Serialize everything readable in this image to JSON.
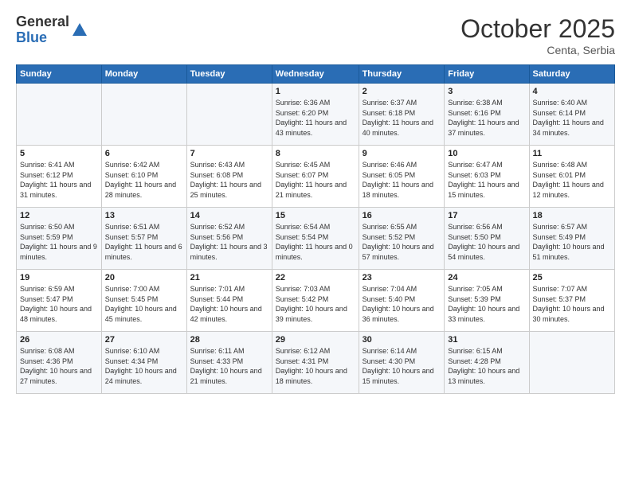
{
  "header": {
    "logo_general": "General",
    "logo_blue": "Blue",
    "month": "October 2025",
    "location": "Centa, Serbia"
  },
  "days_of_week": [
    "Sunday",
    "Monday",
    "Tuesday",
    "Wednesday",
    "Thursday",
    "Friday",
    "Saturday"
  ],
  "weeks": [
    [
      {
        "day": "",
        "info": ""
      },
      {
        "day": "",
        "info": ""
      },
      {
        "day": "",
        "info": ""
      },
      {
        "day": "1",
        "info": "Sunrise: 6:36 AM\nSunset: 6:20 PM\nDaylight: 11 hours and 43 minutes."
      },
      {
        "day": "2",
        "info": "Sunrise: 6:37 AM\nSunset: 6:18 PM\nDaylight: 11 hours and 40 minutes."
      },
      {
        "day": "3",
        "info": "Sunrise: 6:38 AM\nSunset: 6:16 PM\nDaylight: 11 hours and 37 minutes."
      },
      {
        "day": "4",
        "info": "Sunrise: 6:40 AM\nSunset: 6:14 PM\nDaylight: 11 hours and 34 minutes."
      }
    ],
    [
      {
        "day": "5",
        "info": "Sunrise: 6:41 AM\nSunset: 6:12 PM\nDaylight: 11 hours and 31 minutes."
      },
      {
        "day": "6",
        "info": "Sunrise: 6:42 AM\nSunset: 6:10 PM\nDaylight: 11 hours and 28 minutes."
      },
      {
        "day": "7",
        "info": "Sunrise: 6:43 AM\nSunset: 6:08 PM\nDaylight: 11 hours and 25 minutes."
      },
      {
        "day": "8",
        "info": "Sunrise: 6:45 AM\nSunset: 6:07 PM\nDaylight: 11 hours and 21 minutes."
      },
      {
        "day": "9",
        "info": "Sunrise: 6:46 AM\nSunset: 6:05 PM\nDaylight: 11 hours and 18 minutes."
      },
      {
        "day": "10",
        "info": "Sunrise: 6:47 AM\nSunset: 6:03 PM\nDaylight: 11 hours and 15 minutes."
      },
      {
        "day": "11",
        "info": "Sunrise: 6:48 AM\nSunset: 6:01 PM\nDaylight: 11 hours and 12 minutes."
      }
    ],
    [
      {
        "day": "12",
        "info": "Sunrise: 6:50 AM\nSunset: 5:59 PM\nDaylight: 11 hours and 9 minutes."
      },
      {
        "day": "13",
        "info": "Sunrise: 6:51 AM\nSunset: 5:57 PM\nDaylight: 11 hours and 6 minutes."
      },
      {
        "day": "14",
        "info": "Sunrise: 6:52 AM\nSunset: 5:56 PM\nDaylight: 11 hours and 3 minutes."
      },
      {
        "day": "15",
        "info": "Sunrise: 6:54 AM\nSunset: 5:54 PM\nDaylight: 11 hours and 0 minutes."
      },
      {
        "day": "16",
        "info": "Sunrise: 6:55 AM\nSunset: 5:52 PM\nDaylight: 10 hours and 57 minutes."
      },
      {
        "day": "17",
        "info": "Sunrise: 6:56 AM\nSunset: 5:50 PM\nDaylight: 10 hours and 54 minutes."
      },
      {
        "day": "18",
        "info": "Sunrise: 6:57 AM\nSunset: 5:49 PM\nDaylight: 10 hours and 51 minutes."
      }
    ],
    [
      {
        "day": "19",
        "info": "Sunrise: 6:59 AM\nSunset: 5:47 PM\nDaylight: 10 hours and 48 minutes."
      },
      {
        "day": "20",
        "info": "Sunrise: 7:00 AM\nSunset: 5:45 PM\nDaylight: 10 hours and 45 minutes."
      },
      {
        "day": "21",
        "info": "Sunrise: 7:01 AM\nSunset: 5:44 PM\nDaylight: 10 hours and 42 minutes."
      },
      {
        "day": "22",
        "info": "Sunrise: 7:03 AM\nSunset: 5:42 PM\nDaylight: 10 hours and 39 minutes."
      },
      {
        "day": "23",
        "info": "Sunrise: 7:04 AM\nSunset: 5:40 PM\nDaylight: 10 hours and 36 minutes."
      },
      {
        "day": "24",
        "info": "Sunrise: 7:05 AM\nSunset: 5:39 PM\nDaylight: 10 hours and 33 minutes."
      },
      {
        "day": "25",
        "info": "Sunrise: 7:07 AM\nSunset: 5:37 PM\nDaylight: 10 hours and 30 minutes."
      }
    ],
    [
      {
        "day": "26",
        "info": "Sunrise: 6:08 AM\nSunset: 4:36 PM\nDaylight: 10 hours and 27 minutes."
      },
      {
        "day": "27",
        "info": "Sunrise: 6:10 AM\nSunset: 4:34 PM\nDaylight: 10 hours and 24 minutes."
      },
      {
        "day": "28",
        "info": "Sunrise: 6:11 AM\nSunset: 4:33 PM\nDaylight: 10 hours and 21 minutes."
      },
      {
        "day": "29",
        "info": "Sunrise: 6:12 AM\nSunset: 4:31 PM\nDaylight: 10 hours and 18 minutes."
      },
      {
        "day": "30",
        "info": "Sunrise: 6:14 AM\nSunset: 4:30 PM\nDaylight: 10 hours and 15 minutes."
      },
      {
        "day": "31",
        "info": "Sunrise: 6:15 AM\nSunset: 4:28 PM\nDaylight: 10 hours and 13 minutes."
      },
      {
        "day": "",
        "info": ""
      }
    ]
  ]
}
